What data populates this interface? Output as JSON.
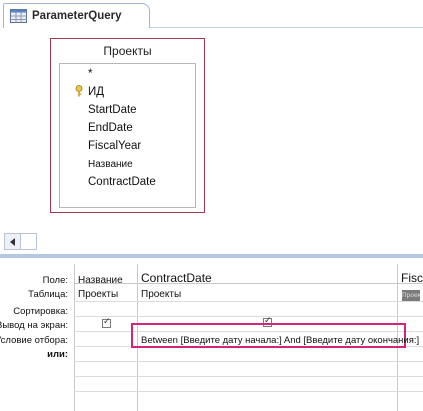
{
  "tab": {
    "label": "ParameterQuery",
    "icon": "query-icon"
  },
  "table": {
    "title": "Проекты",
    "fields": [
      "*",
      "ИД",
      "StartDate",
      "EndDate",
      "FiscalYear",
      "Название",
      "ContractDate"
    ],
    "key_icon": "key-icon"
  },
  "scroll": {
    "left_icon": "scroll-left-icon"
  },
  "grid": {
    "labels": {
      "field": "Поле:",
      "table": "Таблица:",
      "sort": "Сортировка:",
      "show": "Вывод на экран:",
      "criteria": "Условие отбора:",
      "or": "или:"
    },
    "columns": [
      {
        "field": "Название",
        "table": "Проекты",
        "show": true
      },
      {
        "field": "ContractDate",
        "table": "Проекты",
        "show": true,
        "criteria": "Between [Введите дату начала:] And [Введите дату окончания:]"
      },
      {
        "field": "Fisca",
        "table": "Проекты"
      }
    ]
  },
  "colors": {
    "highlight": "#d4247e",
    "table_border": "#a23b52",
    "splitter": "#b7c7e0"
  }
}
